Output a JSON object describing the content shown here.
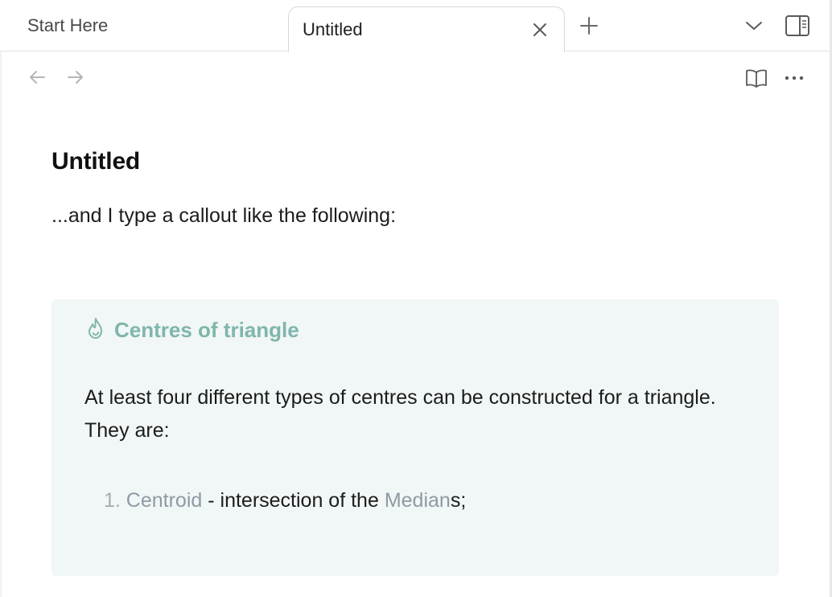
{
  "tabs": [
    {
      "label": "Start Here",
      "active": false
    },
    {
      "label": "Untitled",
      "active": true
    }
  ],
  "icons": {
    "close": "close-icon",
    "new_tab": "plus-icon",
    "tab_list": "chevron-down-icon",
    "sidebar": "right-sidebar-icon",
    "back": "arrow-left-icon",
    "forward": "arrow-right-icon",
    "reading": "book-open-icon",
    "more": "more-horizontal-icon",
    "callout": "flame-icon"
  },
  "note": {
    "title": "Untitled",
    "intro": "...and I type a callout like the following:"
  },
  "callout": {
    "title": "Centres of triangle",
    "body": "At least four different types of centres can be constructed for a triangle. They are:",
    "list_item": {
      "number": "1.",
      "link1": "Centroid",
      "middle": " - intersection of the ",
      "link2": "Median",
      "tail": "s;"
    },
    "accent_color": "#7fb6ac",
    "background": "#f1f6f6"
  }
}
